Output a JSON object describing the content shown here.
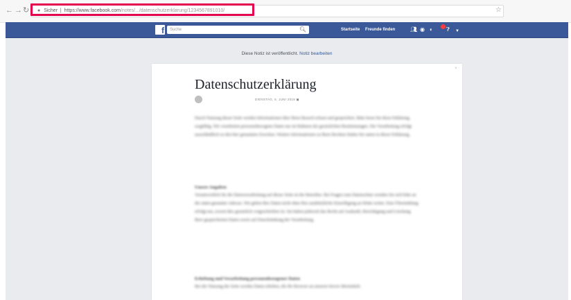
{
  "browser": {
    "back_icon": "arrow-left-icon",
    "forward_icon": "arrow-right-icon",
    "reload_icon": "reload-icon",
    "security_label": "Sicher",
    "url_domain": "https://www.facebook.com",
    "url_path": "/notes/.../datenschutzerklarung/1234567891010/",
    "bookmark_icon": "star-icon",
    "highlight_color": "#e2004f"
  },
  "facebook": {
    "brand_color": "#3b5998",
    "logo": "f",
    "search_placeholder": "Suche",
    "nav_home": "Startseite",
    "nav_friends": "Freunde finden",
    "icons": [
      "friend-requests-icon",
      "messages-icon",
      "notifications-icon",
      "help-icon",
      "dropdown-arrow-icon"
    ]
  },
  "note": {
    "notice_text": "Diese Notiz ist veröffentlicht. ",
    "notice_link": "Notiz bearbeiten",
    "title": "Datenschutzerklärung",
    "date": "DIENSTAG, 5. JUNI 2018",
    "paragraph_1": "Durch Nutzung dieser Seite werden Informationen über Ihren Besuch erfasst und gespeichert. Bitte lesen Sie diese Erklärung sorgfältig. Wir verarbeiten personenbezogene Daten nur im Rahmen der gesetzlichen Bestimmungen. Die Verarbeitung erfolgt ausschließlich zu den hier genannten Zwecken. Weitere Informationen zu Ihren Rechten finden Sie unten in dieser Erklärung.",
    "heading_1": "Unsere Angaben",
    "paragraph_2": "Verantwortlich für die Datenverarbeitung auf dieser Seite ist der Betreiber. Bei Fragen zum Datenschutz wenden Sie sich bitte an die unten genannte Adresse. Wir geben Ihre Daten nicht ohne Ihre ausdrückliche Einwilligung an Dritte weiter. Eine Übermittlung erfolgt nur, soweit dies gesetzlich vorgeschrieben ist. Sie haben jederzeit das Recht auf Auskunft, Berichtigung und Löschung Ihrer gespeicherten Daten sowie auf Einschränkung der Verarbeitung.",
    "heading_2": "Erhebung und Verarbeitung personenbezogener Daten",
    "paragraph_3": "Bei der Nutzung der Seite werden Daten erhoben, die Ihr Browser an unseren Server übermittelt."
  }
}
